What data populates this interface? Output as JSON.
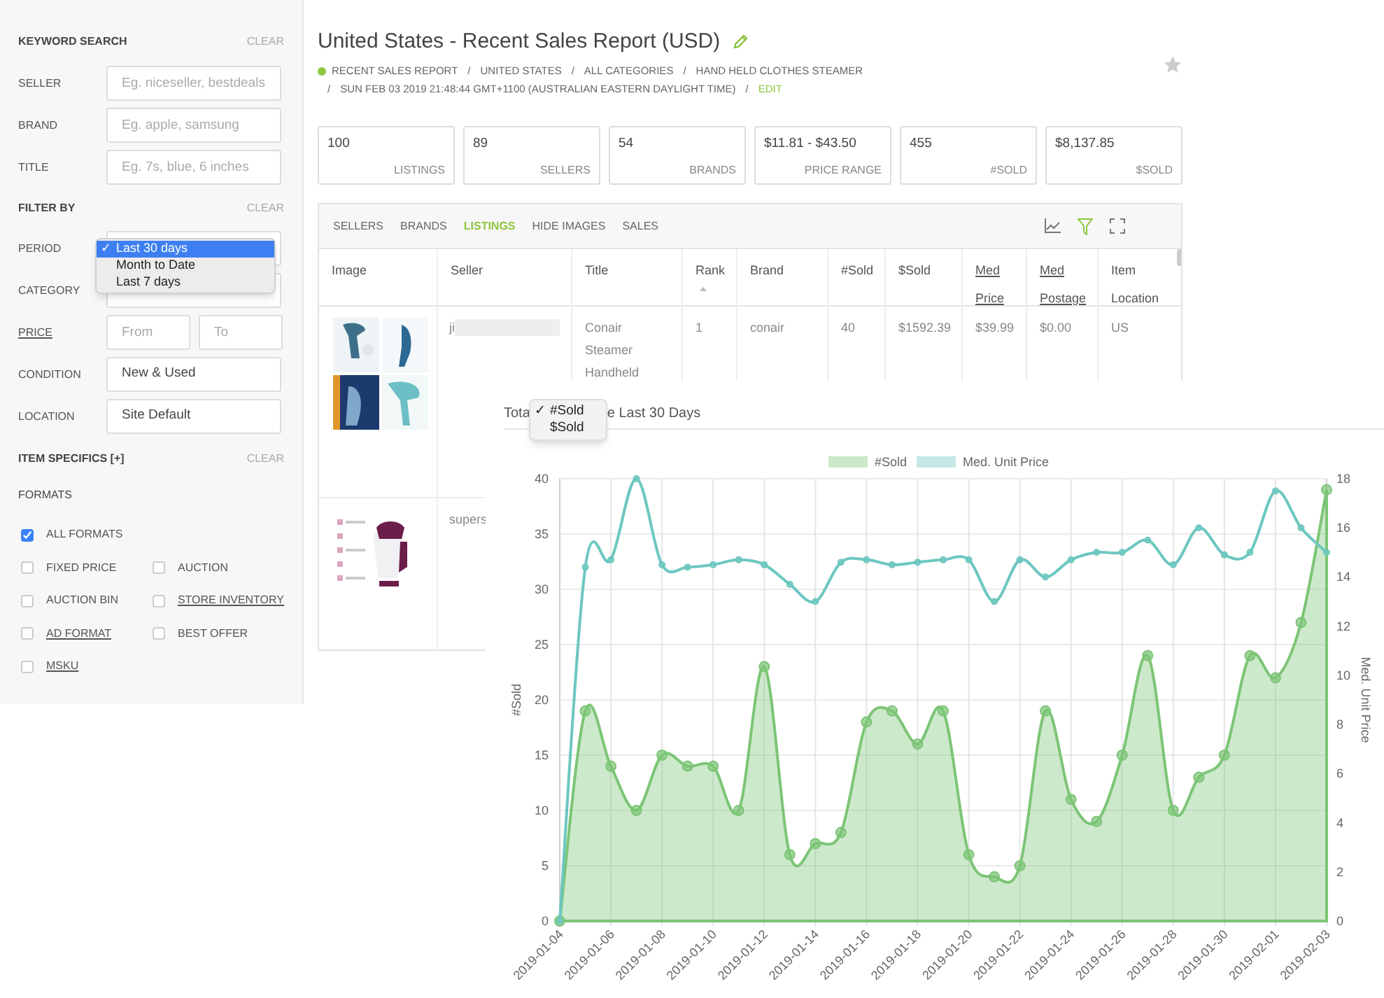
{
  "sidebar": {
    "keyword_search": {
      "heading": "KEYWORD SEARCH",
      "clear": "CLEAR",
      "fields": [
        {
          "label": "SELLER",
          "placeholder": "Eg. niceseller, bestdeals"
        },
        {
          "label": "BRAND",
          "placeholder": "Eg. apple, samsung"
        },
        {
          "label": "TITLE",
          "placeholder": "Eg. 7s, blue, 6 inches"
        }
      ]
    },
    "filter_by": {
      "heading": "FILTER BY",
      "clear": "CLEAR",
      "rows": [
        {
          "kind": "select",
          "label": "PERIOD",
          "link": false
        },
        {
          "kind": "select",
          "label": "CATEGORY",
          "link": false
        },
        {
          "kind": "range",
          "label": "PRICE",
          "link": true,
          "placeholders": [
            "From",
            "To"
          ]
        },
        {
          "kind": "select",
          "label": "CONDITION",
          "link": false,
          "value": "New & Used"
        },
        {
          "kind": "select",
          "label": "LOCATION",
          "link": false,
          "value": "Site Default"
        }
      ]
    },
    "period_menu": {
      "check": "✓",
      "options": [
        {
          "label": "Last 30 days",
          "selected": true
        },
        {
          "label": "Month to Date",
          "selected": false
        },
        {
          "label": "Last 7 days",
          "selected": false
        }
      ]
    },
    "item_specifics": {
      "heading": "ITEM SPECIFICS [+]",
      "clear": "CLEAR"
    },
    "formats": {
      "heading": "FORMATS",
      "options": [
        {
          "label": "ALL FORMATS",
          "checked": true,
          "link": false
        },
        {
          "label": "FIXED PRICE",
          "checked": false,
          "link": false
        },
        {
          "label": "AUCTION",
          "checked": false,
          "link": false
        },
        {
          "label": "AUCTION BIN",
          "checked": false,
          "link": false
        },
        {
          "label": "STORE INVENTORY",
          "checked": false,
          "link": true
        },
        {
          "label": "AD FORMAT",
          "checked": false,
          "link": true
        },
        {
          "label": "BEST OFFER",
          "checked": false,
          "link": false
        },
        {
          "label": "MSKU",
          "checked": false,
          "link": true
        }
      ]
    }
  },
  "report": {
    "title": "United States - Recent Sales Report (USD)",
    "separator": "/",
    "breadcrumb": [
      "RECENT SALES REPORT",
      "UNITED STATES",
      "ALL CATEGORIES",
      "HAND HELD CLOTHES STEAMER",
      "SUN FEB 03 2019 21:48:44 GMT+1100 (AUSTRALIAN EASTERN DAYLIGHT TIME)"
    ],
    "edit": "EDIT",
    "stats": [
      {
        "value": "100",
        "label": "LISTINGS"
      },
      {
        "value": "89",
        "label": "SELLERS"
      },
      {
        "value": "54",
        "label": "BRANDS"
      },
      {
        "value": "$11.81 - $43.50",
        "label": "PRICE RANGE"
      },
      {
        "value": "455",
        "label": "#SOLD"
      },
      {
        "value": "$8,137.85",
        "label": "$SOLD"
      }
    ]
  },
  "table": {
    "tabs": [
      {
        "label": "SELLERS",
        "selected": false
      },
      {
        "label": "BRANDS",
        "selected": false
      },
      {
        "label": "LISTINGS",
        "selected": true
      },
      {
        "label": "HIDE IMAGES",
        "selected": false
      },
      {
        "label": "SALES",
        "selected": false
      }
    ],
    "columns": [
      {
        "label": "Image",
        "link": false,
        "sorted": false
      },
      {
        "label": "Seller",
        "link": false,
        "sorted": false
      },
      {
        "label": "Title",
        "link": false,
        "sorted": false
      },
      {
        "label": "Rank",
        "link": false,
        "sorted": true
      },
      {
        "label": "Brand",
        "link": false,
        "sorted": false
      },
      {
        "label": "#Sold",
        "link": false,
        "sorted": false
      },
      {
        "label": "$Sold",
        "link": false,
        "sorted": false
      },
      {
        "label": "Med Price",
        "link": true,
        "sorted": false
      },
      {
        "label": "Med Postage",
        "link": true,
        "sorted": false
      },
      {
        "label": "Item Location",
        "link": false,
        "sorted": false
      }
    ],
    "rows": [
      {
        "cells": [
          {
            "kind": "picture"
          },
          {
            "kind": "seller",
            "text": "ji",
            "redacted": true
          },
          {
            "kind": "text",
            "text": "Conair Steamer Handheld"
          },
          {
            "kind": "text",
            "text": "1"
          },
          {
            "kind": "text",
            "text": "conair"
          },
          {
            "kind": "text",
            "text": "40"
          },
          {
            "kind": "text",
            "text": "$1592.39"
          },
          {
            "kind": "text",
            "text": "$39.99"
          },
          {
            "kind": "text",
            "text": "$0.00"
          },
          {
            "kind": "text",
            "text": "US"
          }
        ]
      },
      {
        "cells": [
          {
            "kind": "picture"
          },
          {
            "kind": "seller",
            "text": "supers",
            "redacted": false
          }
        ]
      }
    ]
  },
  "chart_panel": {
    "title_parts": [
      "Tota",
      "e Last 30 Days"
    ],
    "menu": {
      "check": "✓",
      "options": [
        {
          "label": "#Sold",
          "selected": true
        },
        {
          "label": "$Sold",
          "selected": false
        }
      ]
    },
    "chart_data": {
      "type": "area",
      "ylabel": "#Sold",
      "y2label": "Med. Unit Price",
      "ylim": [
        0,
        40
      ],
      "y2lim": [
        0,
        18
      ],
      "yticks": [
        0,
        5,
        10,
        15,
        20,
        25,
        30,
        35,
        40
      ],
      "y2ticks": [
        0,
        2,
        4,
        6,
        8,
        10,
        12,
        14,
        16,
        18
      ],
      "x": [
        "2019-01-04",
        "2019-01-05",
        "2019-01-06",
        "2019-01-07",
        "2019-01-08",
        "2019-01-09",
        "2019-01-10",
        "2019-01-11",
        "2019-01-12",
        "2019-01-13",
        "2019-01-14",
        "2019-01-15",
        "2019-01-16",
        "2019-01-17",
        "2019-01-18",
        "2019-01-19",
        "2019-01-20",
        "2019-01-21",
        "2019-01-22",
        "2019-01-23",
        "2019-01-24",
        "2019-01-25",
        "2019-01-26",
        "2019-01-27",
        "2019-01-28",
        "2019-01-29",
        "2019-01-30",
        "2019-01-31",
        "2019-02-01",
        "2019-02-02",
        "2019-02-03"
      ],
      "xlim": [
        "2019-01-04",
        "2019-02-03"
      ],
      "grid": true,
      "legend": "top",
      "xticks": [
        "2019-01-04",
        "2019-01-06",
        "2019-01-08",
        "2019-01-10",
        "2019-01-12",
        "2019-01-14",
        "2019-01-16",
        "2019-01-18",
        "2019-01-20",
        "2019-01-22",
        "2019-01-24",
        "2019-01-26",
        "2019-01-28",
        "2019-01-30",
        "2019-02-01",
        "2019-02-03"
      ],
      "series": [
        {
          "name": "#Sold",
          "color": "#7cc576",
          "type": "area",
          "marker": "circle",
          "values": [
            0,
            19,
            14,
            10,
            15,
            14,
            14,
            10,
            23,
            6,
            7,
            8,
            18,
            19,
            16,
            19,
            6,
            4,
            5,
            19,
            11,
            9,
            15,
            24,
            10,
            13,
            15,
            24,
            22,
            27,
            39
          ]
        },
        {
          "name": "Med. Unit Price",
          "color": "#6cc7bf",
          "type": "line",
          "marker": "circle",
          "axis": "y2",
          "values": [
            0,
            14.4,
            14.7,
            18,
            14.5,
            14.4,
            14.5,
            14.7,
            14.5,
            13.7,
            13,
            14.6,
            14.7,
            14.5,
            14.6,
            14.7,
            14.7,
            13,
            14.7,
            14,
            14.7,
            15,
            15,
            15.5,
            14.5,
            16,
            14.9,
            15,
            17.5,
            16,
            15
          ]
        }
      ]
    }
  }
}
